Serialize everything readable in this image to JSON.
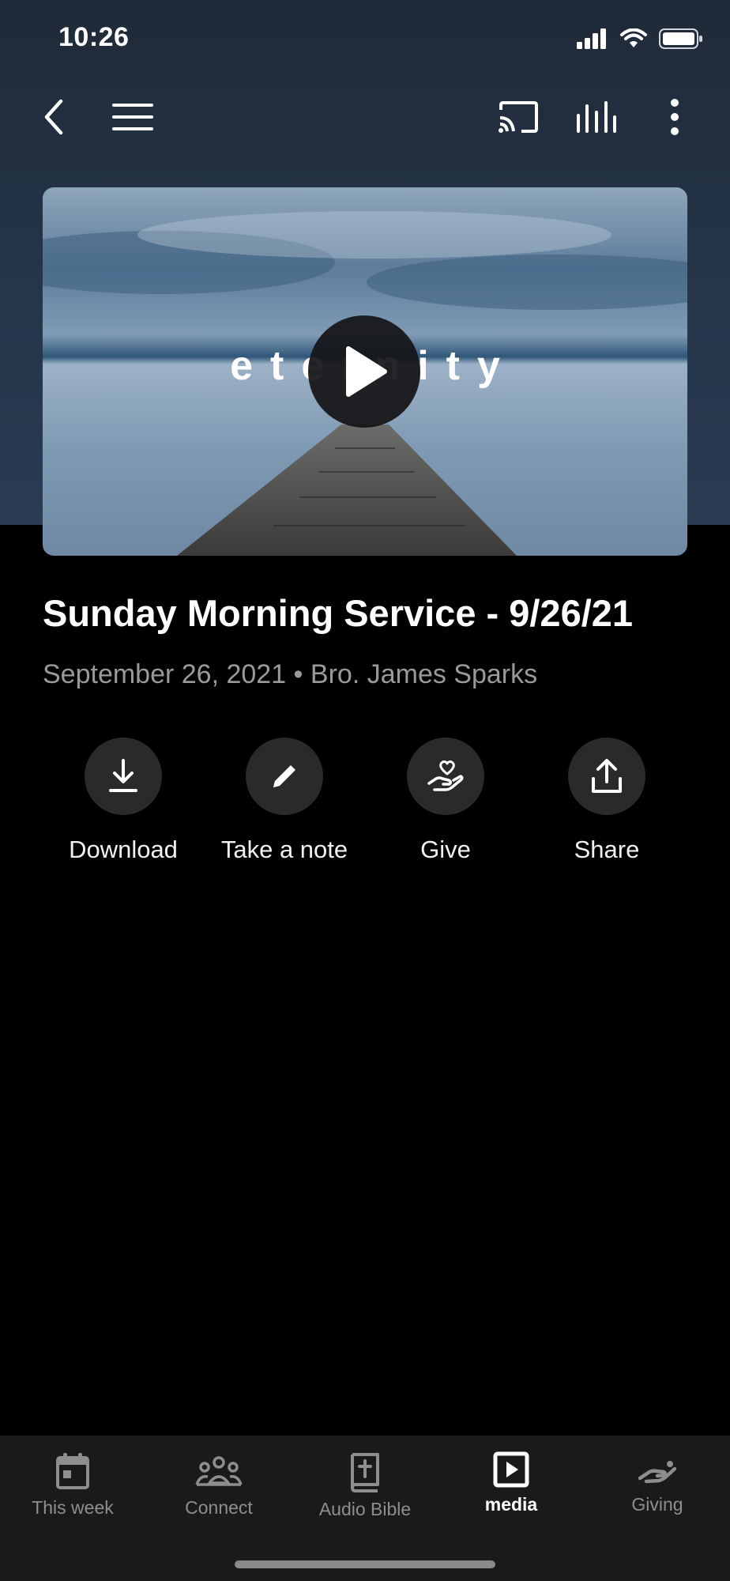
{
  "status_bar": {
    "time": "10:26"
  },
  "toolbar": {
    "back_icon": "chevron-left-icon",
    "menu_icon": "hamburger-menu-icon",
    "cast_icon": "cast-icon",
    "audio_icon": "equalizer-icon",
    "more_icon": "more-vertical-icon"
  },
  "hero": {
    "overlay_text": "eternity"
  },
  "media": {
    "title": "Sunday Morning Service - 9/26/21",
    "subtitle": "September 26, 2021 • Bro. James Sparks"
  },
  "actions": [
    {
      "label": "Download",
      "icon": "download-icon"
    },
    {
      "label": "Take a note",
      "icon": "pencil-icon"
    },
    {
      "label": "Give",
      "icon": "give-hand-heart-icon"
    },
    {
      "label": "Share",
      "icon": "share-icon"
    }
  ],
  "tabs": [
    {
      "label": "This week",
      "icon": "calendar-icon",
      "active": false
    },
    {
      "label": "Connect",
      "icon": "people-icon",
      "active": false
    },
    {
      "label": "Audio Bible",
      "icon": "bible-icon",
      "active": false
    },
    {
      "label": "media",
      "icon": "play-square-icon",
      "active": true
    },
    {
      "label": "Giving",
      "icon": "giving-hand-icon",
      "active": false
    }
  ],
  "colors": {
    "tab_active": "#ffffff",
    "tab_inactive": "#8e8e8e",
    "header_bg": "#25354a"
  }
}
